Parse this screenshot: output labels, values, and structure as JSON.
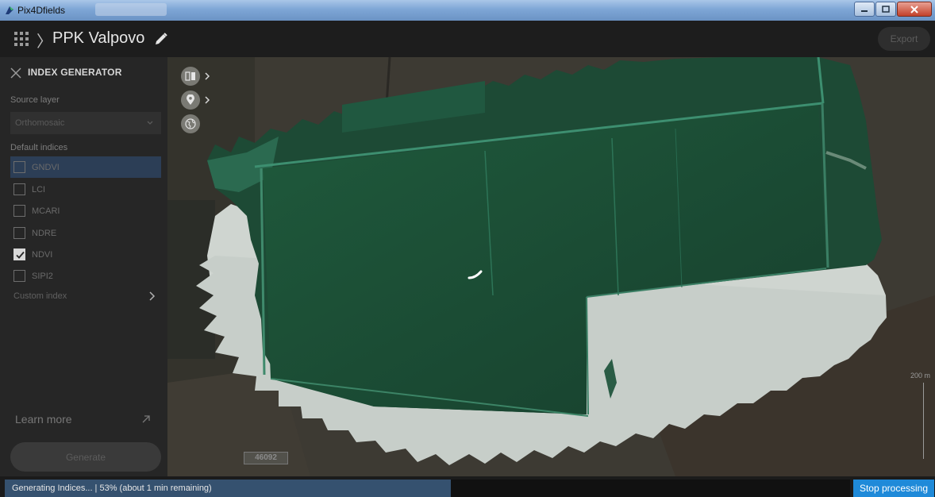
{
  "window": {
    "title": "Pix4Dfields"
  },
  "header": {
    "project_name": "PPK Valpovo",
    "export_label": "Export"
  },
  "panel": {
    "title": "INDEX GENERATOR",
    "source_label": "Source layer",
    "source_value": "Orthomosaic",
    "indices_label": "Default indices",
    "indices": [
      {
        "label": "GNDVI",
        "checked": false,
        "highlighted": true
      },
      {
        "label": "LCI",
        "checked": false
      },
      {
        "label": "MCARI",
        "checked": false
      },
      {
        "label": "NDRE",
        "checked": false
      },
      {
        "label": "NDVI",
        "checked": true
      },
      {
        "label": "SIPI2",
        "checked": false
      }
    ],
    "custom_index_label": "Custom index",
    "learn_more_label": "Learn more",
    "generate_label": "Generate"
  },
  "map": {
    "scale_label": "200 m",
    "road_label": "46092",
    "icons": [
      "layers-compare-icon",
      "location-pin-icon",
      "globe-icon"
    ]
  },
  "status": {
    "text": "Generating Indices... | 53% (about 1 min remaining)",
    "progress": 0.53,
    "stop_label": "Stop processing"
  },
  "colors": {
    "accent": "#1f8ad9",
    "progress": "#35516f",
    "highlight": "#2c3e56"
  }
}
